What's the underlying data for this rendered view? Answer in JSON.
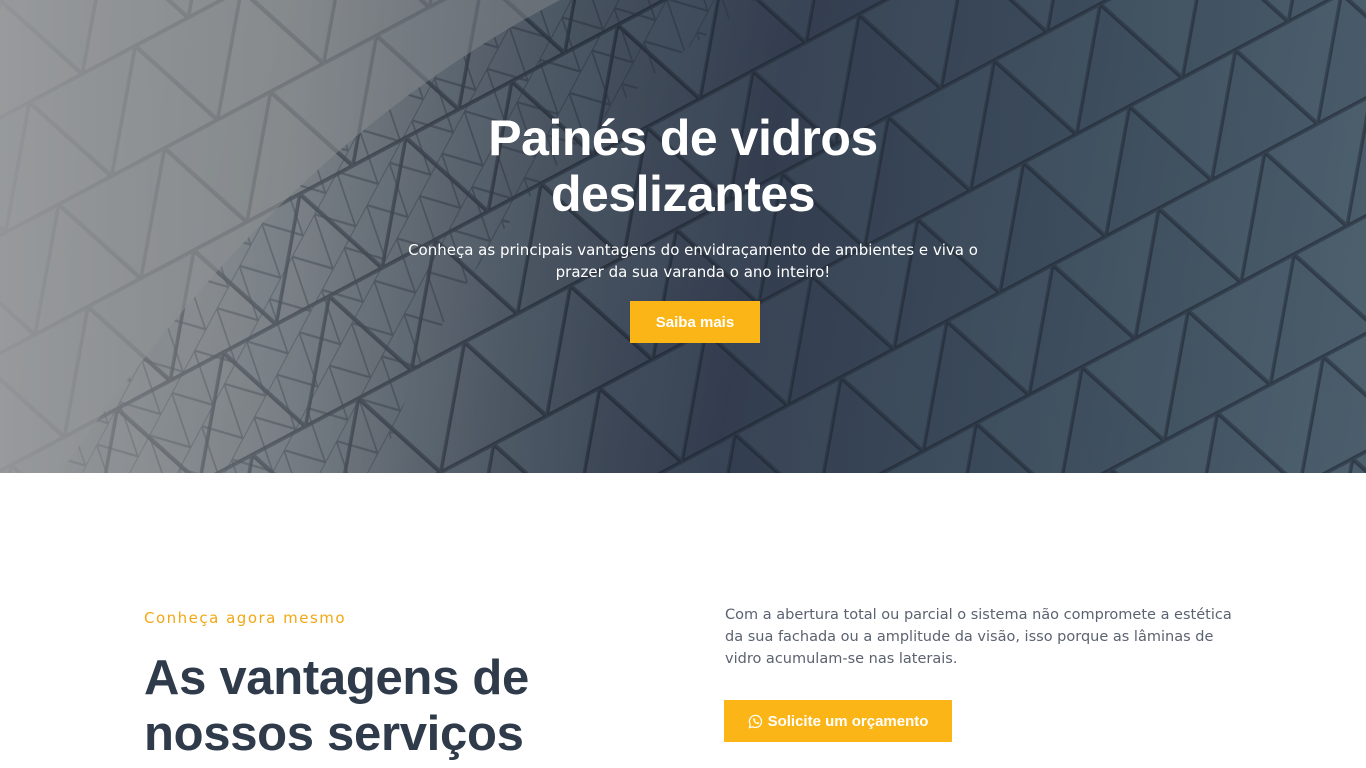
{
  "hero": {
    "title": "Painés de vidros deslizantes",
    "subtitle": "Conheça as principais vantagens do envidraçamento de ambientes e viva o prazer da sua varanda o ano inteiro!",
    "cta_label": "Saiba mais"
  },
  "advantages": {
    "eyebrow": "Conheça agora mesmo",
    "title": "As vantagens de nossos serviços",
    "description": "Com a abertura total ou parcial o sistema não compromete a estética da sua fachada ou a amplitude da visão, isso porque as lâminas de vidro acumulam-se nas laterais.",
    "cta_label": "Solicite um orçamento",
    "cta_icon": "whatsapp-icon"
  },
  "colors": {
    "accent": "#fbb516",
    "eyebrow": "#f3a712",
    "heading": "#2f3b4a",
    "body_text": "#5b6270"
  }
}
